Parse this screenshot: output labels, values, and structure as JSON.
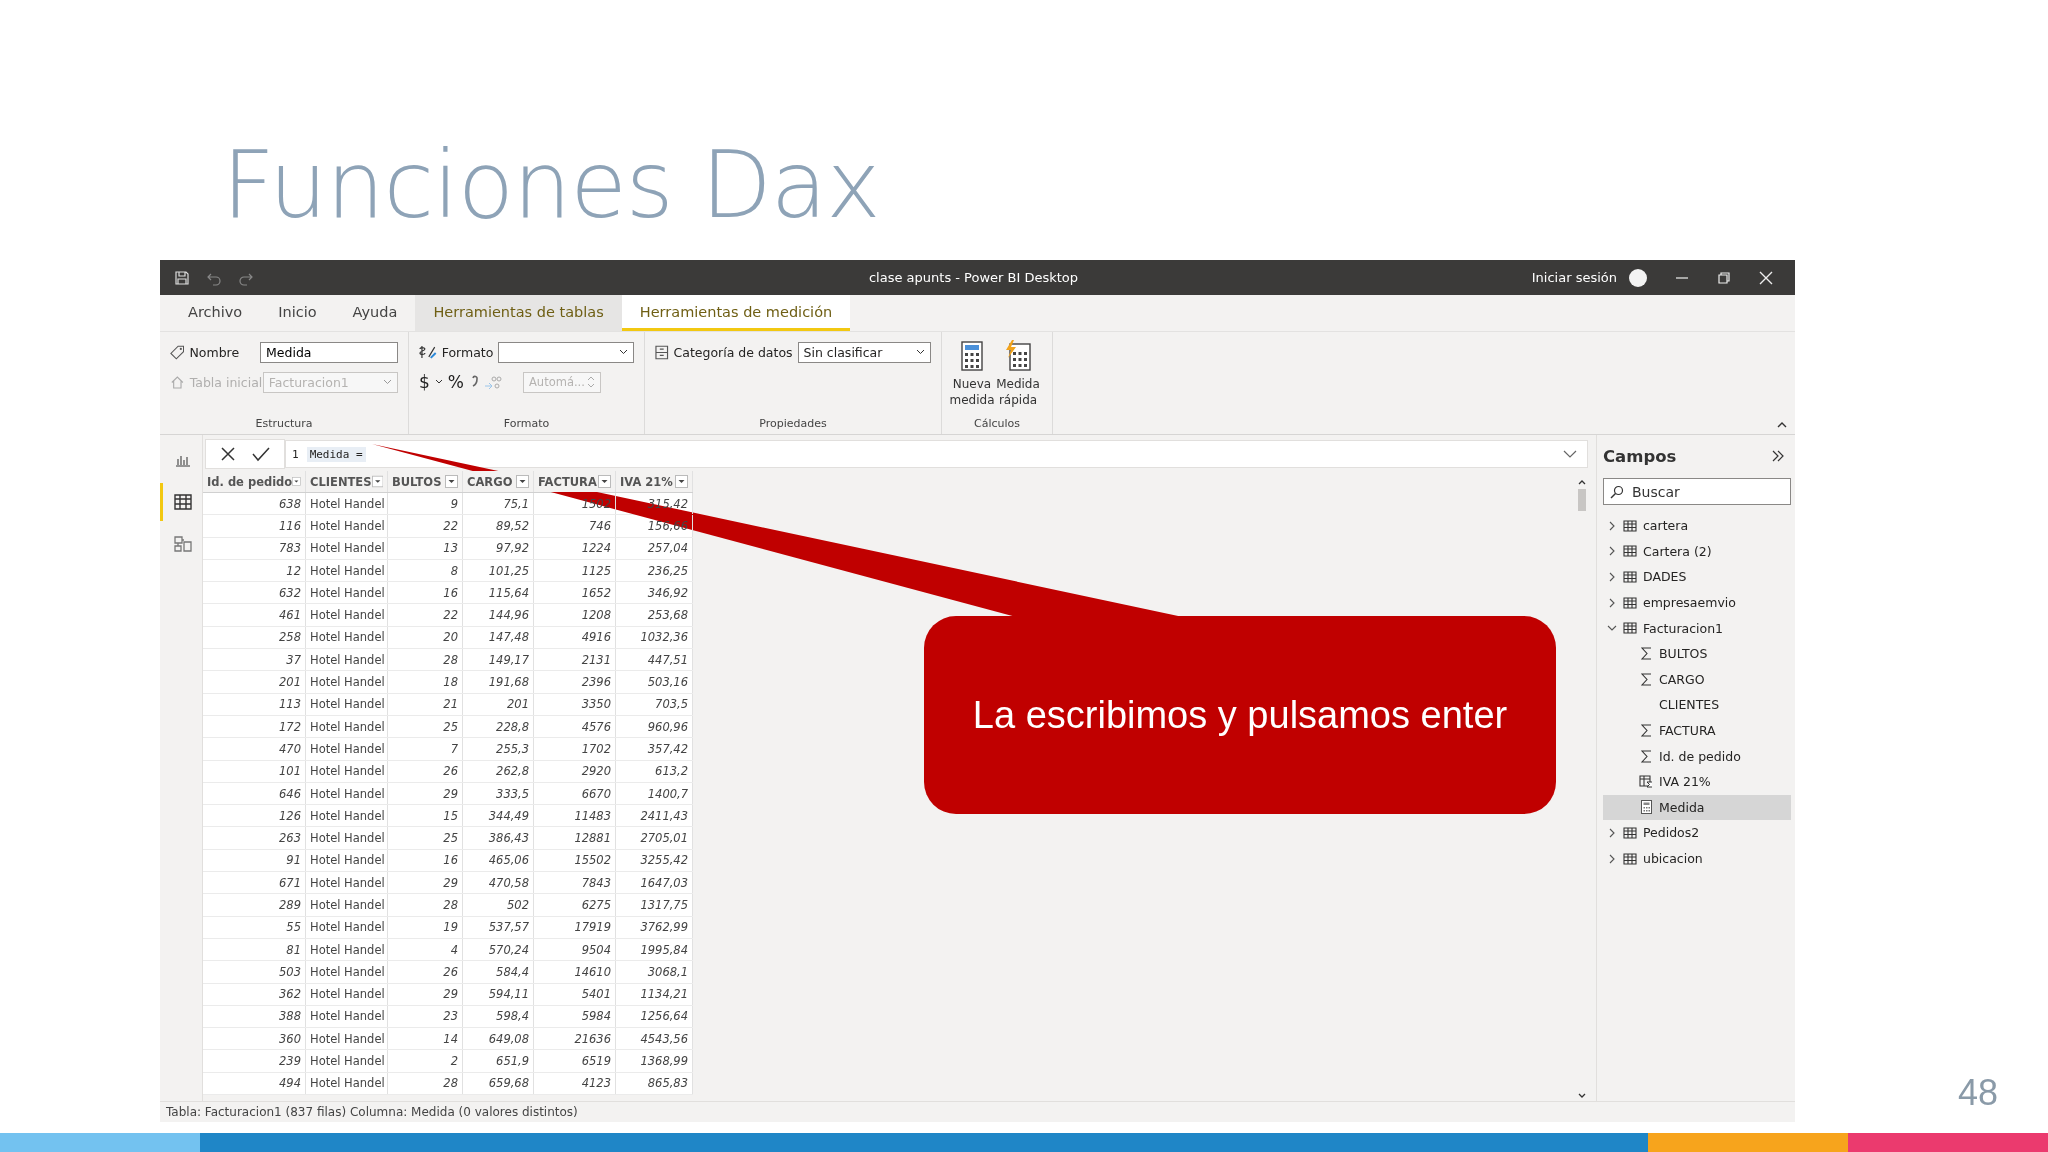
{
  "slide": {
    "title": "Funciones Dax",
    "page_number": "48",
    "callout": "La escribimos y pulsamos enter"
  },
  "window": {
    "title": "clase apunts - Power BI Desktop",
    "sign_in": "Iniciar sesión"
  },
  "tabs": [
    {
      "label": "Archivo",
      "kind": "standard",
      "selected": false
    },
    {
      "label": "Inicio",
      "kind": "standard",
      "selected": false
    },
    {
      "label": "Ayuda",
      "kind": "standard",
      "selected": false
    },
    {
      "label": "Herramientas de tablas",
      "kind": "contextual",
      "selected": false
    },
    {
      "label": "Herramientas de medición",
      "kind": "contextual",
      "selected": true
    }
  ],
  "ribbon": {
    "structure": {
      "group": "Estructura",
      "name_label": "Nombre",
      "name_value": "Medida",
      "home_table_label": "Tabla inicial",
      "home_table_value": "Facturacion1",
      "home_table_disabled": true
    },
    "format": {
      "group": "Formato",
      "format_label": "Formato",
      "currency": "$",
      "percent": "%",
      "decimals": "Automá...",
      "decimals_disabled": true
    },
    "properties": {
      "group": "Propiedades",
      "category_label": "Categoría de datos",
      "category_value": "Sin clasificar"
    },
    "calculations": {
      "group": "Cálculos",
      "new_measure": "Nueva medida",
      "quick_measure": "Medida rápida"
    }
  },
  "formula_bar": {
    "line_number": "1",
    "formula": "Medida ="
  },
  "table": {
    "columns": [
      "Id. de pedido",
      "CLIENTES",
      "BULTOS",
      "CARGO",
      "FACTURA",
      "IVA 21%"
    ],
    "rows": [
      [
        "638",
        "Hotel Handel",
        "9",
        "75,1",
        "1502",
        "315,42"
      ],
      [
        "116",
        "Hotel Handel",
        "22",
        "89,52",
        "746",
        "156,66"
      ],
      [
        "783",
        "Hotel Handel",
        "13",
        "97,92",
        "1224",
        "257,04"
      ],
      [
        "12",
        "Hotel Handel",
        "8",
        "101,25",
        "1125",
        "236,25"
      ],
      [
        "632",
        "Hotel Handel",
        "16",
        "115,64",
        "1652",
        "346,92"
      ],
      [
        "461",
        "Hotel Handel",
        "22",
        "144,96",
        "1208",
        "253,68"
      ],
      [
        "258",
        "Hotel Handel",
        "20",
        "147,48",
        "4916",
        "1032,36"
      ],
      [
        "37",
        "Hotel Handel",
        "28",
        "149,17",
        "2131",
        "447,51"
      ],
      [
        "201",
        "Hotel Handel",
        "18",
        "191,68",
        "2396",
        "503,16"
      ],
      [
        "113",
        "Hotel Handel",
        "21",
        "201",
        "3350",
        "703,5"
      ],
      [
        "172",
        "Hotel Handel",
        "25",
        "228,8",
        "4576",
        "960,96"
      ],
      [
        "470",
        "Hotel Handel",
        "7",
        "255,3",
        "1702",
        "357,42"
      ],
      [
        "101",
        "Hotel Handel",
        "26",
        "262,8",
        "2920",
        "613,2"
      ],
      [
        "646",
        "Hotel Handel",
        "29",
        "333,5",
        "6670",
        "1400,7"
      ],
      [
        "126",
        "Hotel Handel",
        "15",
        "344,49",
        "11483",
        "2411,43"
      ],
      [
        "263",
        "Hotel Handel",
        "25",
        "386,43",
        "12881",
        "2705,01"
      ],
      [
        "91",
        "Hotel Handel",
        "16",
        "465,06",
        "15502",
        "3255,42"
      ],
      [
        "671",
        "Hotel Handel",
        "29",
        "470,58",
        "7843",
        "1647,03"
      ],
      [
        "289",
        "Hotel Handel",
        "28",
        "502",
        "6275",
        "1317,75"
      ],
      [
        "55",
        "Hotel Handel",
        "19",
        "537,57",
        "17919",
        "3762,99"
      ],
      [
        "81",
        "Hotel Handel",
        "4",
        "570,24",
        "9504",
        "1995,84"
      ],
      [
        "503",
        "Hotel Handel",
        "26",
        "584,4",
        "14610",
        "3068,1"
      ],
      [
        "362",
        "Hotel Handel",
        "29",
        "594,11",
        "5401",
        "1134,21"
      ],
      [
        "388",
        "Hotel Handel",
        "23",
        "598,4",
        "5984",
        "1256,64"
      ],
      [
        "360",
        "Hotel Handel",
        "14",
        "649,08",
        "21636",
        "4543,56"
      ],
      [
        "239",
        "Hotel Handel",
        "2",
        "651,9",
        "6519",
        "1368,99"
      ],
      [
        "494",
        "Hotel Handel",
        "28",
        "659,68",
        "4123",
        "865,83"
      ]
    ]
  },
  "fields": {
    "title": "Campos",
    "search_placeholder": "Buscar",
    "items": [
      {
        "label": "cartera",
        "kind": "table",
        "expanded": false,
        "selected": false
      },
      {
        "label": "Cartera (2)",
        "kind": "table",
        "expanded": false,
        "selected": false
      },
      {
        "label": "DADES",
        "kind": "table",
        "expanded": false,
        "selected": false
      },
      {
        "label": "empresaemvio",
        "kind": "table",
        "expanded": false,
        "selected": false
      },
      {
        "label": "Facturacion1",
        "kind": "table",
        "expanded": true,
        "selected": false,
        "children": [
          {
            "label": "BULTOS",
            "kind": "sum",
            "selected": false
          },
          {
            "label": "CARGO",
            "kind": "sum",
            "selected": false
          },
          {
            "label": "CLIENTES",
            "kind": "text",
            "selected": false
          },
          {
            "label": "FACTURA",
            "kind": "sum",
            "selected": false
          },
          {
            "label": "Id. de pedido",
            "kind": "sum",
            "selected": false
          },
          {
            "label": "IVA 21%",
            "kind": "calc_column",
            "selected": false
          },
          {
            "label": "Medida",
            "kind": "measure",
            "selected": true
          }
        ]
      },
      {
        "label": "Pedidos2",
        "kind": "table",
        "expanded": false,
        "selected": false
      },
      {
        "label": "ubicacion",
        "kind": "table",
        "expanded": false,
        "selected": false
      }
    ]
  },
  "status_bar": "Tabla: Facturacion1 (837 filas) Columna: Medida (0 valores distintos)"
}
